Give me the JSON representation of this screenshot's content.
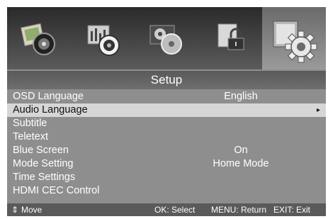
{
  "header": {
    "title": "Setup"
  },
  "icon_bar": [
    {
      "icon": "picture-speaker-icon"
    },
    {
      "icon": "audio-settings-icon"
    },
    {
      "icon": "channel-disc-icon"
    },
    {
      "icon": "lock-icon"
    },
    {
      "icon": "setup-gear-icon",
      "selected": true
    }
  ],
  "menu": {
    "items": [
      {
        "label": "OSD Language",
        "value": "English"
      },
      {
        "label": "Audio Language",
        "value": "",
        "arrow": "▸",
        "highlighted": true
      },
      {
        "label": "Subtitle",
        "value": ""
      },
      {
        "label": "Teletext",
        "value": ""
      },
      {
        "label": "Blue Screen",
        "value": "On"
      },
      {
        "label": "Mode Setting",
        "value": "Home Mode"
      },
      {
        "label": "Time Settings",
        "value": ""
      },
      {
        "label": "HDMI CEC Control",
        "value": ""
      }
    ]
  },
  "footer": {
    "move_icon": "⇕",
    "move": "Move",
    "select": "OK: Select",
    "return": "MENU: Return",
    "exit": "EXIT: Exit"
  },
  "colors": {
    "highlight": "#d6d6d6",
    "panel": "#8e8e8e",
    "title_bar": "#666666"
  }
}
